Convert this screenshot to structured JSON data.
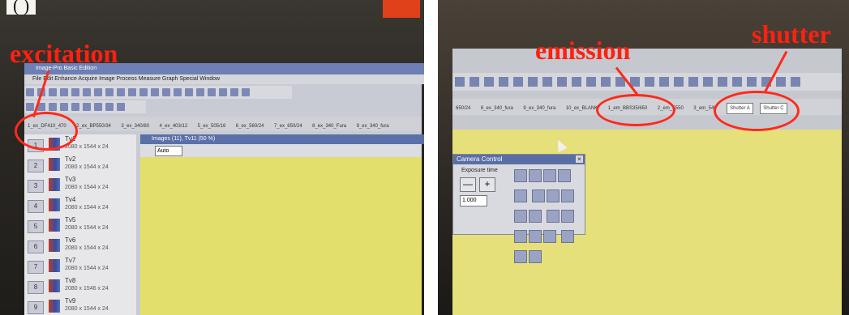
{
  "left_photo": {
    "top_caption": "(        )",
    "annotation_label": "excitation",
    "window_title": "Image-Pro Basic Edition",
    "menu": "File  Edit  Enhance  Acquire  Image  Process  Measure  Graph  Special  Window",
    "tabs": [
      "1_ex_DF410_470",
      "2_ex_BP550/34",
      "3_ex_340/80",
      "4_ex_403/12",
      "5_ex_505/16",
      "6_ex_560/24",
      "7_ex_650/24",
      "8_ex_340_Fura",
      "9_ex_340_fura"
    ],
    "image_window_title": "Images (11), Tv11 (50 %)",
    "zoom_select": "Auto",
    "image_list": [
      {
        "num": "1",
        "name": "Tv1",
        "size": "2080 x 1544 x 24"
      },
      {
        "num": "2",
        "name": "Tv2",
        "size": "2080 x 1544 x 24"
      },
      {
        "num": "3",
        "name": "Tv3",
        "size": "2080 x 1544 x 24"
      },
      {
        "num": "4",
        "name": "Tv4",
        "size": "2080 x 1544 x 24"
      },
      {
        "num": "5",
        "name": "Tv5",
        "size": "2080 x 1544 x 24"
      },
      {
        "num": "6",
        "name": "Tv6",
        "size": "2080 x 1544 x 24"
      },
      {
        "num": "7",
        "name": "Tv7",
        "size": "2080 x 1544 x 24"
      },
      {
        "num": "8",
        "name": "Tv8",
        "size": "2080 x 1546 x 24"
      },
      {
        "num": "9",
        "name": "Tv9",
        "size": "2080 x 1544 x 24"
      }
    ]
  },
  "right_photo": {
    "emission_label": "emission",
    "shutter_label": "shutter",
    "tabs": [
      "650/24",
      "8_ex_340_fura",
      "9_ex_340_fura",
      "10_ex_BLANK",
      "1_em_BBS35/650",
      "2_em_F550",
      "3_em_540",
      "Shutter A",
      "Shutter C"
    ],
    "camera_panel_title": "Camera Control",
    "exposure_label": "Exposure time",
    "exposure_minus": "—",
    "exposure_plus": "+",
    "exposure_value": "1.000"
  },
  "colors": {
    "annotation": "#ff2a1a",
    "screen_yellow": "#e3df6b",
    "titlebar": "#5b6fa8"
  }
}
